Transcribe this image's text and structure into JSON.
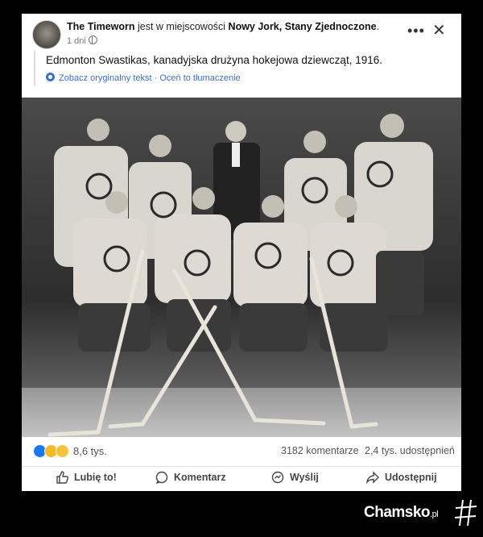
{
  "post": {
    "author": "The Timeworn",
    "in_text": "jest w miejscowości",
    "location": "Nowy Jork, Stany Zjednoczone",
    "period": ".",
    "time": "1 dni",
    "text": "Edmonton Swastikas, kanadyjska drużyna hokejowa dziewcząt, 1916.",
    "see_original": "Zobacz oryginalny tekst",
    "separator": "·",
    "rate_translation": "Oceń to tłumaczenie"
  },
  "stats": {
    "reactions": "8,6 tys.",
    "comments": "3182 komentarze",
    "shares": "2,4 tys. udostępnień"
  },
  "actions": {
    "like": "Lubię to!",
    "comment": "Komentarz",
    "send": "Wyślij",
    "share": "Udostępnij"
  },
  "watermark": {
    "brand": "Chamsko",
    "tld": ".pl"
  },
  "icons": [
    "globe-icon",
    "more-icon",
    "close-icon",
    "translate-gear-icon",
    "like-icon",
    "comment-icon",
    "messenger-icon",
    "share-icon",
    "hashtag-icon"
  ]
}
